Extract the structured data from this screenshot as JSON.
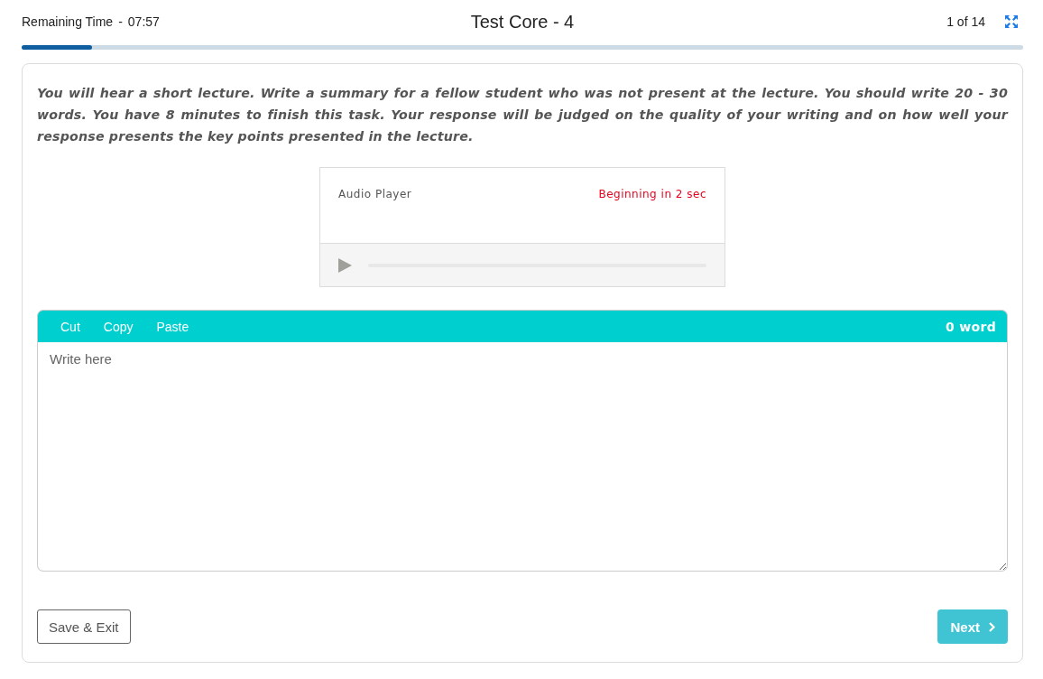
{
  "header": {
    "remaining_label": "Remaining Time",
    "separator": "-",
    "remaining_time": "07:57",
    "title": "Test Core - 4",
    "page_counter": "1 of 14"
  },
  "progress": {
    "level": 0.07
  },
  "instructions": "You will hear a short lecture. Write a summary for a fellow student who was not present at the lecture. You should write 20 - 30 words. You have 8 minutes to finish this task. Your response will be judged on the quality of your writing and on how well your response presents the key points presented in the lecture.",
  "audio_player": {
    "label": "Audio Player",
    "status": "Beginning in 2 sec"
  },
  "editor": {
    "tools": [
      "Cut",
      "Copy",
      "Paste"
    ],
    "word_count": "0 word",
    "placeholder": "Write here"
  },
  "buttons": {
    "save": "Save & Exit",
    "next": "Next"
  }
}
